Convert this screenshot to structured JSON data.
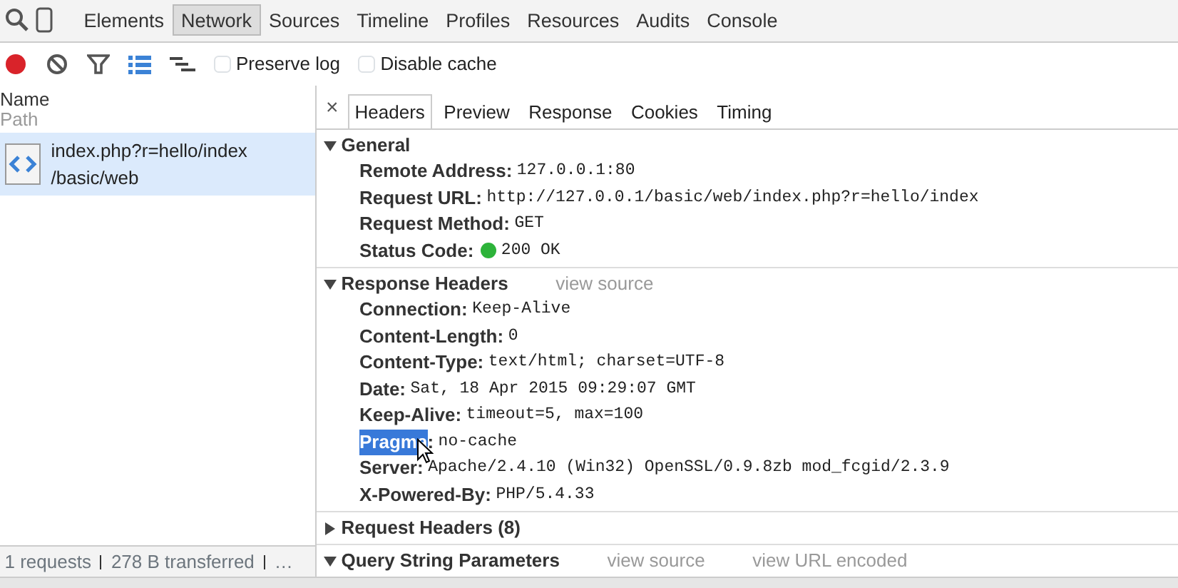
{
  "top_tabs": [
    {
      "label": "Elements",
      "selected": false
    },
    {
      "label": "Network",
      "selected": true
    },
    {
      "label": "Sources",
      "selected": false
    },
    {
      "label": "Timeline",
      "selected": false
    },
    {
      "label": "Profiles",
      "selected": false
    },
    {
      "label": "Resources",
      "selected": false
    },
    {
      "label": "Audits",
      "selected": false
    },
    {
      "label": "Console",
      "selected": false
    }
  ],
  "toolbar": {
    "recording": true,
    "checkboxes": [
      {
        "label": "Preserve log",
        "checked": false
      },
      {
        "label": "Disable cache",
        "checked": false
      }
    ]
  },
  "requests": {
    "columns": [
      "Name",
      "Path"
    ],
    "rows": [
      {
        "name": "index.php?r=hello/index",
        "path": "/basic/web",
        "selected": true
      }
    ]
  },
  "status_bar": [
    "1 requests",
    "278 B transferred",
    "…"
  ],
  "detail": {
    "close": "×",
    "tabs": [
      {
        "label": "Headers",
        "selected": true
      },
      {
        "label": "Preview",
        "selected": false
      },
      {
        "label": "Response",
        "selected": false
      },
      {
        "label": "Cookies",
        "selected": false
      },
      {
        "label": "Timing",
        "selected": false
      }
    ],
    "sections": [
      {
        "title": "General",
        "expanded": true,
        "rows": [
          {
            "name": "Remote Address:",
            "value": "127.0.0.1:80",
            "highlighted": false
          },
          {
            "name": "Request URL:",
            "value": "http://127.0.0.1/basic/web/index.php?r=hello/index",
            "highlighted": false
          },
          {
            "name": "Request Method:",
            "value": "GET",
            "highlighted": false
          },
          {
            "name": "Status Code:",
            "value": "200 OK",
            "highlighted": false,
            "color": "#2db33a"
          }
        ]
      },
      {
        "title": "Response Headers",
        "expanded": true,
        "links": [
          "view source"
        ],
        "rows": [
          {
            "name": "Connection:",
            "value": "Keep-Alive",
            "highlighted": false
          },
          {
            "name": "Content-Length:",
            "value": "0",
            "highlighted": false
          },
          {
            "name": "Content-Type:",
            "value": "text/html; charset=UTF-8",
            "highlighted": false
          },
          {
            "name": "Date:",
            "value": "Sat, 18 Apr 2015 09:29:07 GMT",
            "highlighted": false
          },
          {
            "name": "Keep-Alive:",
            "value": "timeout=5, max=100",
            "highlighted": false
          },
          {
            "name": "Pragma",
            "sep": ":",
            "value": "no-cache",
            "highlighted": true,
            "cursor": true
          },
          {
            "name": "Server:",
            "value": "Apache/2.4.10 (Win32) OpenSSL/0.9.8zb mod_fcgid/2.3.9",
            "highlighted": false
          },
          {
            "name": "X-Powered-By:",
            "value": "PHP/5.4.33",
            "highlighted": false
          }
        ]
      },
      {
        "title": "Request Headers (8)",
        "expanded": false
      },
      {
        "title": "Query String Parameters",
        "expanded": true,
        "links": [
          "view source",
          "view URL encoded"
        ]
      }
    ]
  }
}
